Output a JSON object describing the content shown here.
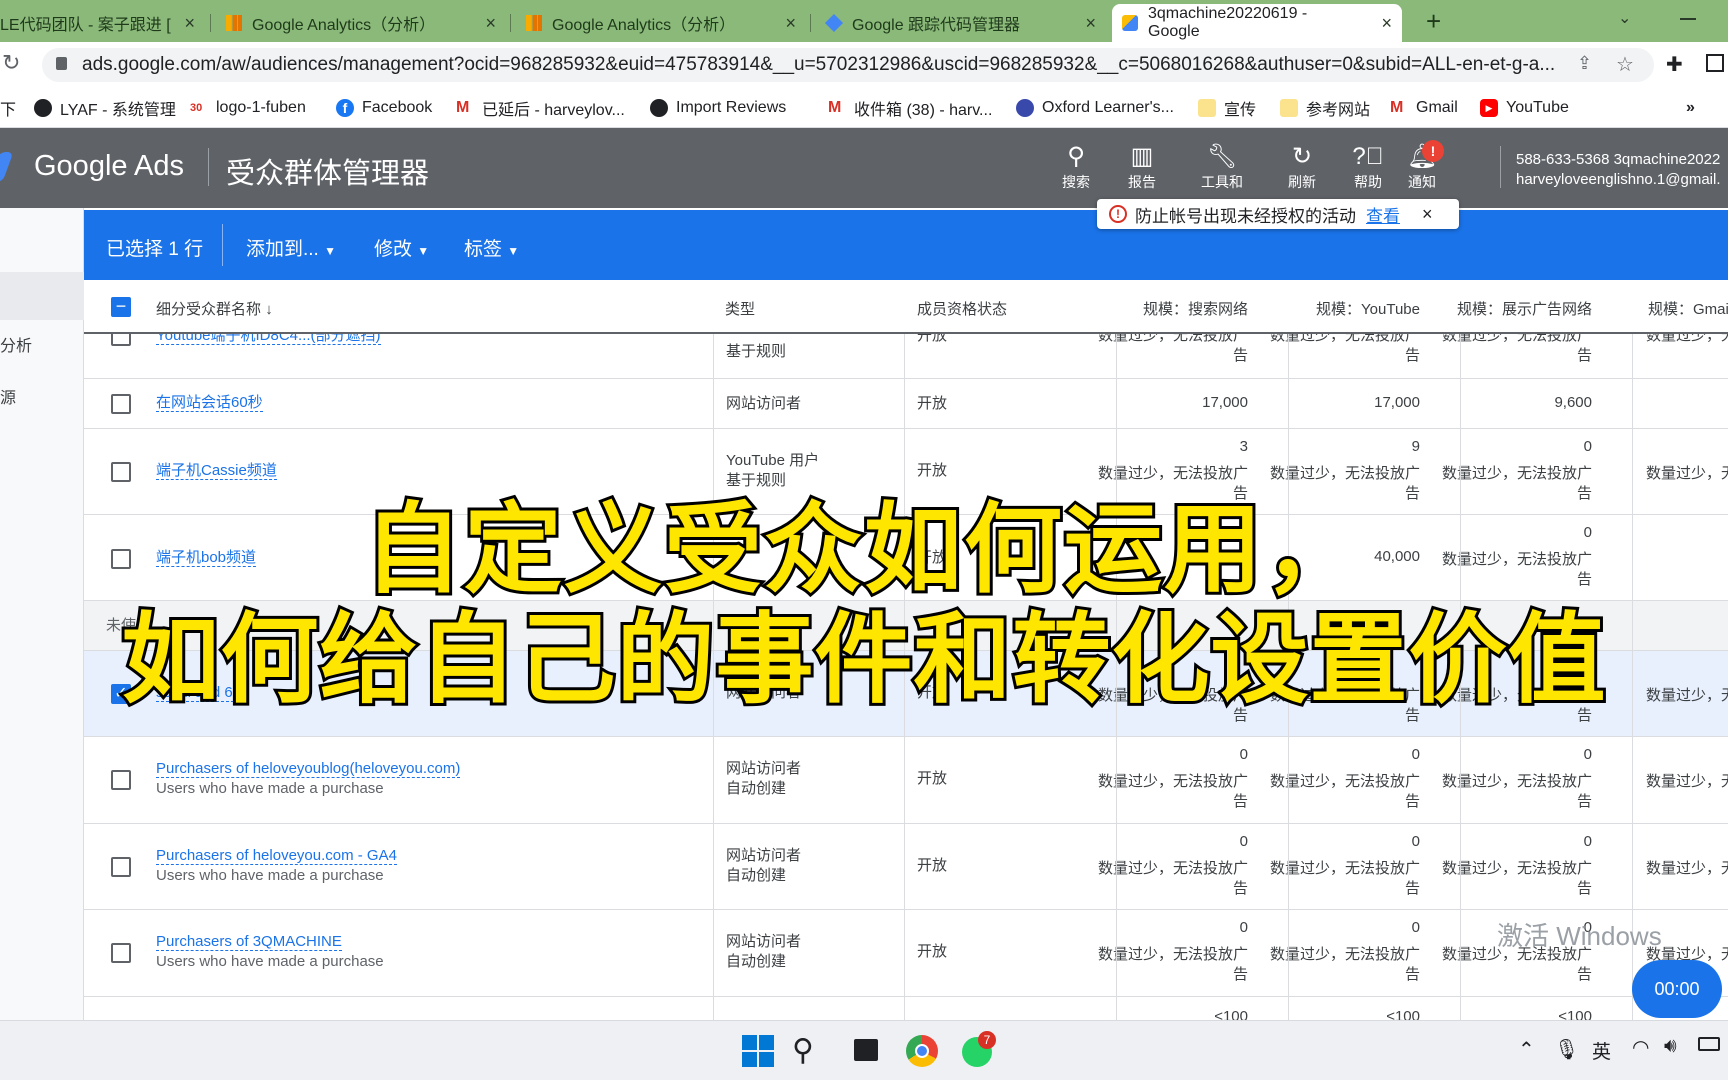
{
  "browser": {
    "tabs": [
      {
        "label": "LE代码团队 - 案子跟进 [",
        "active": false
      },
      {
        "label": "Google Analytics（分析）",
        "active": false
      },
      {
        "label": "Google Analytics（分析）",
        "active": false
      },
      {
        "label": "Google 跟踪代码管理器",
        "active": false
      },
      {
        "label": "3qmachine20220619 - Google",
        "active": true
      }
    ],
    "new_tab": "+",
    "url": "ads.google.com/aw/audiences/management?ocid=968285932&euid=475783914&__u=5702312986&uscid=968285932&__c=5068016268&authuser=0&subid=ALL-en-et-g-a...",
    "bookmarks": [
      "下",
      "LYAF - 系统管理",
      "logo-1-fuben",
      "Facebook",
      "已延后 - harveylov...",
      "Import Reviews",
      "收件箱 (38) - harv...",
      "Oxford Learner's...",
      "宣传",
      "参考网站",
      "Gmail",
      "YouTube"
    ],
    "more": "»"
  },
  "ads": {
    "brand": "Google Ads",
    "page_title": "受众群体管理器",
    "header_buttons": [
      "搜索",
      "报告",
      "工具和",
      "刷新",
      "帮助",
      "通知"
    ],
    "account_line1": "588-633-5368 3qmachine2022",
    "account_line2": "harveyloveenglishno.1@gmail.",
    "notice": {
      "text": "防止帐号出现未经授权的活动",
      "link": "查看",
      "close": "×"
    },
    "leftnav": [
      "分析",
      "源"
    ],
    "selection_bar": {
      "selected": "已选择 1 行",
      "add_to": "添加到...",
      "modify": "修改",
      "label": "标签"
    }
  },
  "table": {
    "headers": [
      "细分受众群名称",
      "类型",
      "成员资格状态",
      "规模：搜索网络",
      "规模：YouTube",
      "规模：展示广告网络",
      "规模：Gmail"
    ],
    "sort_arrow": "↓",
    "partial_top": {
      "name": "Youtube端子机ID8C4...(部分遮挡)",
      "type": "基于规则",
      "status": "开放",
      "cols": [
        "数量过少，无法投放广告",
        "数量过少，无法投放广告",
        "数量过少，无法投放广告",
        "数量过少，无"
      ]
    },
    "rows": [
      {
        "name": "在网站会话60秒",
        "sub": "",
        "type": "网站访问者",
        "type2": "",
        "status": "开放",
        "search": "17,000",
        "search_note": "",
        "yt": "17,000",
        "yt_note": "",
        "display": "9,600",
        "display_note": "",
        "gmail": ""
      },
      {
        "name": "端子机Cassie频道",
        "sub": "",
        "type": "YouTube 用户",
        "type2": "基于规则",
        "status": "开放",
        "search": "3",
        "search_note": "数量过少，无法投放广告",
        "yt": "9",
        "yt_note": "数量过少，无法投放广告",
        "display": "0",
        "display_note": "数量过少，无法投放广告",
        "gmail": "数量过少，无"
      },
      {
        "name": "端子机bob频道",
        "sub": "",
        "type": "",
        "type2": "",
        "status": "开放",
        "search": "",
        "search_note": "",
        "yt": "40,000",
        "yt_note": "",
        "display": "0",
        "display_note": "数量过少，无法投放广告",
        "gmail": ""
      },
      {
        "name": "scroll and 60s",
        "sub": "",
        "type": "网站访问者",
        "type2": "",
        "status": "开放",
        "search": "",
        "search_note": "数量过少，无法投放广告",
        "yt": "",
        "yt_note": "数量过少，无法投放广告",
        "display": "0",
        "display_note": "数量过少，无法投放广告",
        "gmail": "数量过少，无"
      },
      {
        "name": "Purchasers of heloveyoublog(heloveyou.com)",
        "sub": "Users who have made a purchase",
        "type": "网站访问者",
        "type2": "自动创建",
        "status": "开放",
        "search": "0",
        "search_note": "数量过少，无法投放广告",
        "yt": "0",
        "yt_note": "数量过少，无法投放广告",
        "display": "0",
        "display_note": "数量过少，无法投放广告",
        "gmail": "数量过少，无"
      },
      {
        "name": "Purchasers of heloveyou.com - GA4",
        "sub": "Users who have made a purchase",
        "type": "网站访问者",
        "type2": "自动创建",
        "status": "开放",
        "search": "0",
        "search_note": "数量过少，无法投放广告",
        "yt": "0",
        "yt_note": "数量过少，无法投放广告",
        "display": "0",
        "display_note": "数量过少，无法投放广告",
        "gmail": "数量过少，无"
      },
      {
        "name": "Purchasers of 3QMACHINE",
        "sub": "Users who have made a purchase",
        "type": "网站访问者",
        "type2": "自动创建",
        "status": "开放",
        "search": "0",
        "search_note": "数量过少，无法投放广告",
        "yt": "0",
        "yt_note": "数量过少，无法投放广告",
        "display": "0",
        "display_note": "数量过少，无法投放广告",
        "gmail": "数量过少，无"
      }
    ],
    "partial_bottom": [
      "<100",
      "<100",
      "<100"
    ],
    "unused_label": "未使"
  },
  "overlay": {
    "line1": "自定义受众如何运用，",
    "line2": "如何给自己的事件和转化设置价值"
  },
  "watermark": "激活 Windows",
  "timer": "00:00",
  "taskbar": {
    "badge": "7",
    "lang": "英"
  },
  "colors": {
    "accent": "#1a73e8",
    "header": "#5f6368",
    "tabstrip": "#8ab97a",
    "caption": "#ffe600"
  }
}
